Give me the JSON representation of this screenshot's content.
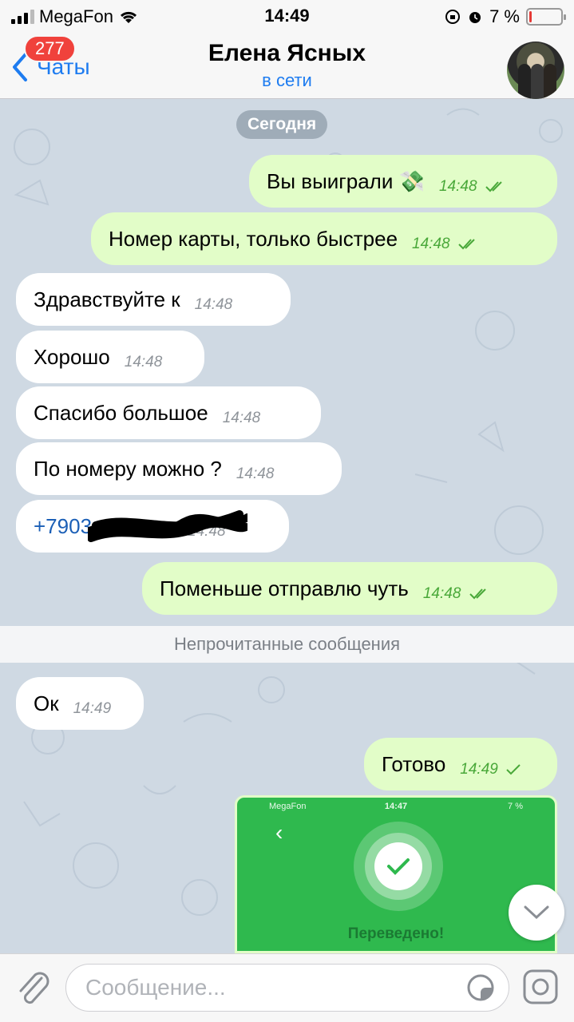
{
  "status_bar": {
    "carrier": "MegaFon",
    "time": "14:49",
    "battery_text": "7 %",
    "battery_level": 0.07
  },
  "nav": {
    "back_label": "Чаты",
    "unread_badge": "277",
    "title": "Елена Ясных",
    "subtitle": "в сети"
  },
  "chat": {
    "date_label": "Сегодня",
    "messages": [
      {
        "dir": "out",
        "text": "Вы выиграли 💸",
        "time": "14:48"
      },
      {
        "dir": "out",
        "text": "Номер карты, только быстрее",
        "time": "14:48"
      },
      {
        "dir": "in",
        "text": "Здравствуйте к",
        "time": "14:48"
      },
      {
        "dir": "in",
        "text": "Хорошо",
        "time": "14:48"
      },
      {
        "dir": "in",
        "text": "Спасибо большое",
        "time": "14:48"
      },
      {
        "dir": "in",
        "text": "По номеру можно ?",
        "time": "14:48"
      },
      {
        "dir": "in",
        "text": "+7903",
        "time": "14:48"
      },
      {
        "dir": "out",
        "text": "Поменьше отправлю чуть",
        "time": "14:48"
      },
      {
        "dir": "in",
        "text": "Ок",
        "time": "14:49"
      },
      {
        "dir": "out",
        "text": "Готово",
        "time": "14:49"
      }
    ],
    "unread_label": "Непрочитанные сообщения",
    "screenshot": {
      "carrier": "MegaFon",
      "time": "14:47",
      "battery_text": "7 %",
      "status": "Переведено!"
    }
  },
  "input": {
    "placeholder": "Сообщение..."
  },
  "colors": {
    "accent": "#1e7cf0",
    "outgoing_bubble": "#e2fdc8",
    "incoming_bubble": "#ffffff",
    "badge": "#f0423c",
    "transfer_green": "#2fb94e"
  }
}
